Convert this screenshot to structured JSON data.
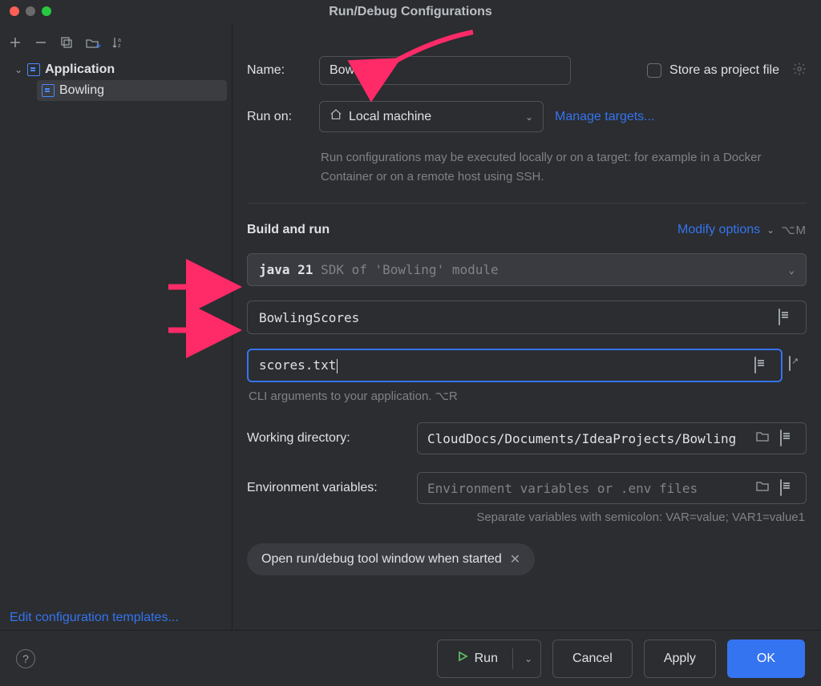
{
  "title": "Run/Debug Configurations",
  "sidebar": {
    "group": "Application",
    "item": "Bowling",
    "edit_templates": "Edit configuration templates..."
  },
  "name": {
    "label": "Name:",
    "value": "Bowling"
  },
  "store": {
    "label": "Store as project file"
  },
  "run_on": {
    "label": "Run on:",
    "value": "Local machine",
    "manage": "Manage targets...",
    "hint": "Run configurations may be executed locally or on a target: for example in a Docker Container or on a remote host using SSH."
  },
  "build_run": {
    "heading": "Build and run",
    "modify": "Modify options",
    "modify_shortcut": "⌥M",
    "jdk_bold": "java 21",
    "jdk_rest": " SDK of 'Bowling' module",
    "main_class": "BowlingScores",
    "args": "scores.txt",
    "cli_hint": "CLI arguments to your application. ⌥R",
    "wd_label": "Working directory:",
    "wd_value": "CloudDocs/Documents/IdeaProjects/Bowling",
    "env_label": "Environment variables:",
    "env_placeholder": "Environment variables or .env files",
    "env_hint": "Separate variables with semicolon: VAR=value; VAR1=value1",
    "chip": "Open run/debug tool window when started"
  },
  "footer": {
    "run": "Run",
    "cancel": "Cancel",
    "apply": "Apply",
    "ok": "OK"
  }
}
